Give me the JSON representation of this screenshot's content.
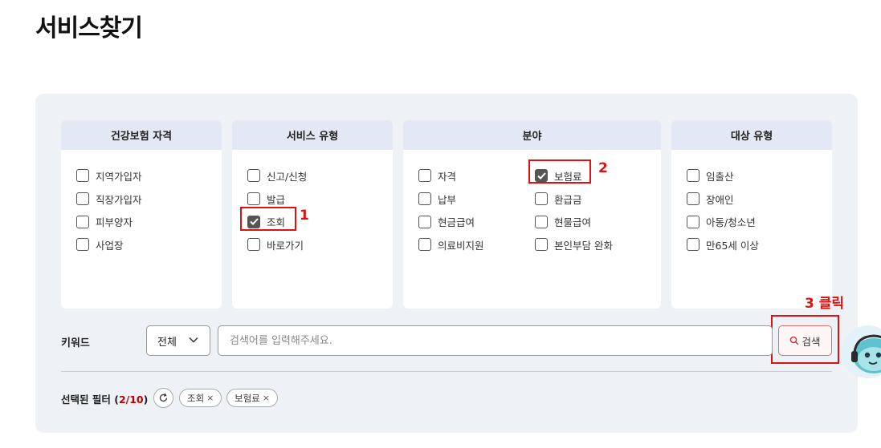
{
  "page": {
    "title": "서비스찾기"
  },
  "categories": [
    {
      "title": "건강보험 자격",
      "options": [
        {
          "label": "지역가입자",
          "checked": false
        },
        {
          "label": "직장가입자",
          "checked": false
        },
        {
          "label": "피부양자",
          "checked": false
        },
        {
          "label": "사업장",
          "checked": false
        }
      ]
    },
    {
      "title": "서비스 유형",
      "options": [
        {
          "label": "신고/신청",
          "checked": false
        },
        {
          "label": "발급",
          "checked": false
        },
        {
          "label": "조회",
          "checked": true
        },
        {
          "label": "바로가기",
          "checked": false
        }
      ]
    },
    {
      "title": "분야",
      "options": [
        {
          "label": "자격",
          "checked": false
        },
        {
          "label": "보험료",
          "checked": true
        },
        {
          "label": "납부",
          "checked": false
        },
        {
          "label": "환급금",
          "checked": false
        },
        {
          "label": "현금급여",
          "checked": false
        },
        {
          "label": "현물급여",
          "checked": false
        },
        {
          "label": "의료비지원",
          "checked": false
        },
        {
          "label": "본인부담 완화",
          "checked": false
        }
      ]
    },
    {
      "title": "대상 유형",
      "options": [
        {
          "label": "임출산",
          "checked": false
        },
        {
          "label": "장애인",
          "checked": false
        },
        {
          "label": "아동/청소년",
          "checked": false
        },
        {
          "label": "만65세 이상",
          "checked": false
        }
      ]
    }
  ],
  "annotations": {
    "step1": "1",
    "step2": "2",
    "step3": "3 클릭"
  },
  "keyword": {
    "label": "키워드",
    "scope_value": "전체",
    "placeholder": "검색어를 입력해주세요.",
    "search_label": "검색"
  },
  "filters": {
    "label": "선택된 필터",
    "count": "2/10",
    "chips": [
      {
        "label": "조회"
      },
      {
        "label": "보험료"
      }
    ],
    "remove_glyph": "×"
  },
  "colors": {
    "accent_red": "#e01010",
    "card_header": "#e3e8f5",
    "panel_bg": "#eef1f6",
    "count_red": "#c00000"
  },
  "icons": [
    "checkmark-icon",
    "chevron-down-icon",
    "search-icon",
    "refresh-icon",
    "close-icon",
    "mascot-icon"
  ]
}
